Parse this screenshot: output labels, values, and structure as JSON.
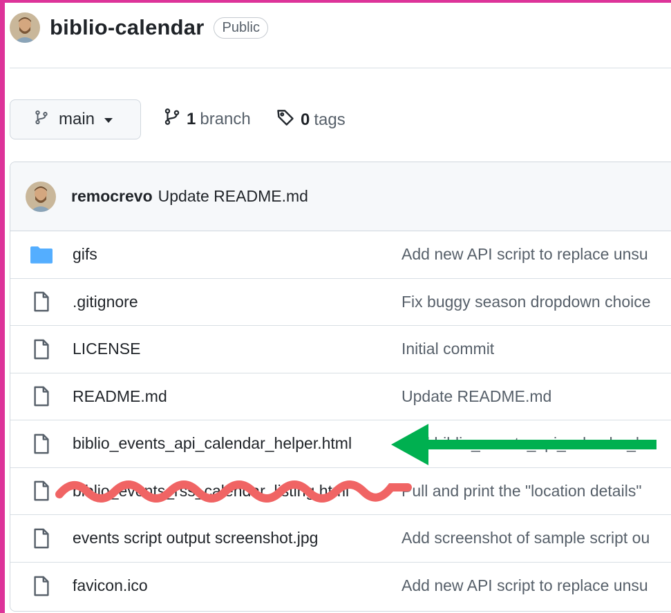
{
  "repo": {
    "name": "biblio-calendar",
    "visibility": "Public"
  },
  "toolbar": {
    "branch_label": "main",
    "branch_count": "1",
    "branch_word": "branch",
    "tag_count": "0",
    "tag_word": "tags"
  },
  "latest_commit": {
    "author": "remocrevo",
    "message": "Update README.md"
  },
  "files": [
    {
      "name": "gifs",
      "type": "folder",
      "commit": "Add new API script to replace unsu"
    },
    {
      "name": ".gitignore",
      "type": "file",
      "commit": "Fix buggy season dropdown choice"
    },
    {
      "name": "LICENSE",
      "type": "file",
      "commit": "Initial commit"
    },
    {
      "name": "README.md",
      "type": "file",
      "commit": "Update README.md"
    },
    {
      "name": "biblio_events_api_calendar_helper.html",
      "type": "file",
      "commit": "Add biblio_events_api_calendar_h"
    },
    {
      "name": "biblio_events_rss_calendar_listing.html",
      "type": "file",
      "commit": "Pull and print the \"location details\""
    },
    {
      "name": "events script output screenshot.jpg",
      "type": "file",
      "commit": "Add screenshot of sample script ou"
    },
    {
      "name": "favicon.ico",
      "type": "file",
      "commit": "Add new API script to replace unsu"
    }
  ],
  "annotations": {
    "arrow_color": "#00b050",
    "scribble_color": "#f06464",
    "frame_color": "#dd3399"
  },
  "icons": {
    "avatar": "user-avatar",
    "branch": "git-branch-icon",
    "tag": "tag-icon",
    "folder": "folder-icon",
    "file": "file-icon"
  }
}
